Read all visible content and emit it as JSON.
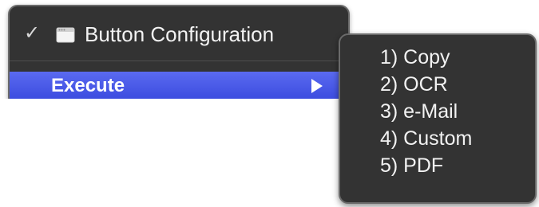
{
  "main_menu": {
    "top_item": {
      "checked": true,
      "check_glyph": "✓",
      "icon": "window-icon",
      "label": "Button Configuration"
    },
    "highlighted_item": {
      "label": "Execute",
      "has_submenu": true
    }
  },
  "submenu": {
    "items": [
      {
        "label": "1) Copy"
      },
      {
        "label": "2) OCR"
      },
      {
        "label": "3) e-Mail"
      },
      {
        "label": "4) Custom"
      },
      {
        "label": "5) PDF"
      }
    ]
  },
  "colors": {
    "menu_background": "#333333",
    "menu_border": "#6a6a6a",
    "highlight": "#4858ea",
    "text": "#f2f2f2"
  }
}
